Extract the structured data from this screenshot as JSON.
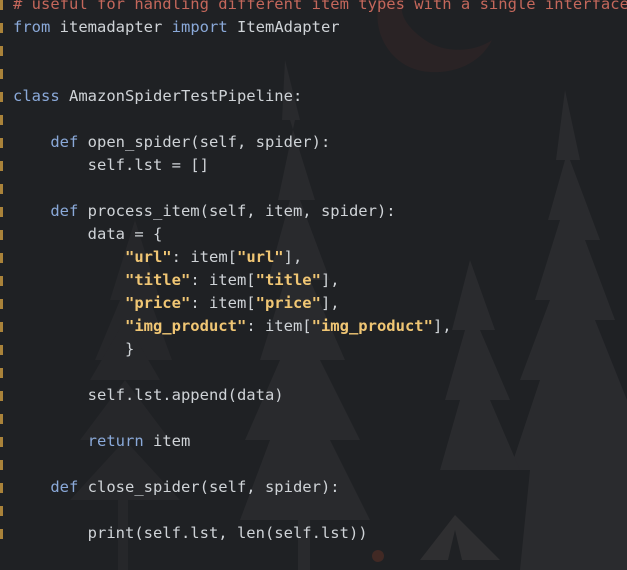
{
  "editor": {
    "language": "python",
    "theme_background": "#1f2124",
    "colors": {
      "keyword": "#8aa9d9",
      "comment": "#c4675b",
      "string": "#f0c674",
      "text": "#cfd3d7"
    },
    "lines": [
      {
        "indent": 0,
        "tokens": [
          {
            "t": "cm",
            "v": "# useful for handling different item types with a single interface"
          }
        ]
      },
      {
        "indent": 0,
        "tokens": [
          {
            "t": "kw",
            "v": "from"
          },
          {
            "t": "plain",
            "v": " itemadapter "
          },
          {
            "t": "kw",
            "v": "import"
          },
          {
            "t": "plain",
            "v": " ItemAdapter"
          }
        ]
      },
      {
        "indent": 0,
        "tokens": []
      },
      {
        "indent": 0,
        "tokens": []
      },
      {
        "indent": 0,
        "tokens": [
          {
            "t": "kw",
            "v": "class"
          },
          {
            "t": "plain",
            "v": " AmazonSpiderTestPipeline:"
          }
        ]
      },
      {
        "indent": 0,
        "tokens": []
      },
      {
        "indent": 4,
        "tokens": [
          {
            "t": "kw",
            "v": "def"
          },
          {
            "t": "plain",
            "v": " open_spider(self, spider):"
          }
        ]
      },
      {
        "indent": 8,
        "tokens": [
          {
            "t": "plain",
            "v": "self.lst = []"
          }
        ]
      },
      {
        "indent": 0,
        "tokens": []
      },
      {
        "indent": 4,
        "tokens": [
          {
            "t": "kw",
            "v": "def"
          },
          {
            "t": "plain",
            "v": " process_item(self, item, spider):"
          }
        ]
      },
      {
        "indent": 8,
        "tokens": [
          {
            "t": "plain",
            "v": "data = {"
          }
        ]
      },
      {
        "indent": 12,
        "tokens": [
          {
            "t": "str",
            "v": "\"url\""
          },
          {
            "t": "plain",
            "v": ": item["
          },
          {
            "t": "str",
            "v": "\"url\""
          },
          {
            "t": "plain",
            "v": "],"
          }
        ]
      },
      {
        "indent": 12,
        "tokens": [
          {
            "t": "str",
            "v": "\"title\""
          },
          {
            "t": "plain",
            "v": ": item["
          },
          {
            "t": "str",
            "v": "\"title\""
          },
          {
            "t": "plain",
            "v": "],"
          }
        ]
      },
      {
        "indent": 12,
        "tokens": [
          {
            "t": "str",
            "v": "\"price\""
          },
          {
            "t": "plain",
            "v": ": item["
          },
          {
            "t": "str",
            "v": "\"price\""
          },
          {
            "t": "plain",
            "v": "],"
          }
        ]
      },
      {
        "indent": 12,
        "tokens": [
          {
            "t": "str",
            "v": "\"img_product\""
          },
          {
            "t": "plain",
            "v": ": item["
          },
          {
            "t": "str",
            "v": "\"img_product\""
          },
          {
            "t": "plain",
            "v": "],"
          }
        ]
      },
      {
        "indent": 12,
        "tokens": [
          {
            "t": "plain",
            "v": "}"
          }
        ]
      },
      {
        "indent": 0,
        "tokens": []
      },
      {
        "indent": 8,
        "tokens": [
          {
            "t": "plain",
            "v": "self.lst.append(data)"
          }
        ]
      },
      {
        "indent": 0,
        "tokens": []
      },
      {
        "indent": 8,
        "tokens": [
          {
            "t": "kw",
            "v": "return"
          },
          {
            "t": "plain",
            "v": " item"
          }
        ]
      },
      {
        "indent": 0,
        "tokens": []
      },
      {
        "indent": 4,
        "tokens": [
          {
            "t": "kw",
            "v": "def"
          },
          {
            "t": "plain",
            "v": " close_spider(self, spider):"
          }
        ]
      },
      {
        "indent": 0,
        "tokens": []
      },
      {
        "indent": 8,
        "tokens": [
          {
            "t": "plain",
            "v": "print(self.lst, len(self.lst))"
          }
        ]
      }
    ]
  }
}
